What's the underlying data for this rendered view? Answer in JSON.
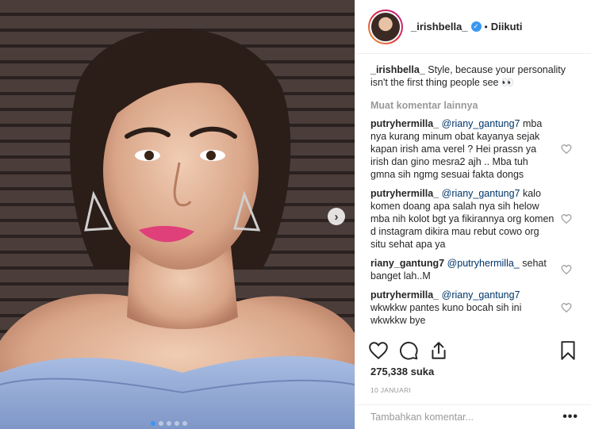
{
  "post": {
    "username": "_irishbella_",
    "follow_status": "Diikuti",
    "separator": "•",
    "caption_text": "Style, because your personality isn't the first thing people see 👀",
    "load_more": "Muat komentar lainnya",
    "comments": [
      {
        "user": "putryhermilla_",
        "mention": "@riany_gantung7",
        "text": "mba nya kurang minum obat kayanya sejak kapan irish ama verel ? Hei prassn ya irish dan gino mesra2 ajh .. Mba tuh gmna sih ngmg sesuai fakta dongs"
      },
      {
        "user": "putryhermilla_",
        "mention": "@riany_gantung7",
        "text": "kalo komen doang apa salah nya sih helow mba nih kolot bgt ya fikirannya org komen d instagram dikira mau rebut cowo org situ sehat apa ya"
      },
      {
        "user": "riany_gantung7",
        "mention": "@putryhermilla_",
        "text": "sehat banget lah..M"
      },
      {
        "user": "putryhermilla_",
        "mention": "@riany_gantung7",
        "text": "wkwkkw pantes kuno bocah sih ini wkwkkw bye"
      }
    ],
    "likes": "275,338 suka",
    "date": "10 JANUARI",
    "add_comment_placeholder": "Tambahkan komentar...",
    "more_label": "•••",
    "next_label": "›"
  },
  "icons": {
    "like": "heart-icon",
    "comment": "comment-icon",
    "share": "share-icon",
    "save": "bookmark-icon",
    "verified": "verified-badge-icon"
  },
  "colors": {
    "accent": "#3897f0",
    "mention": "#003569",
    "muted": "#999999",
    "text": "#262626"
  },
  "carousel": {
    "total_slides": 5,
    "active_slide": 1
  }
}
